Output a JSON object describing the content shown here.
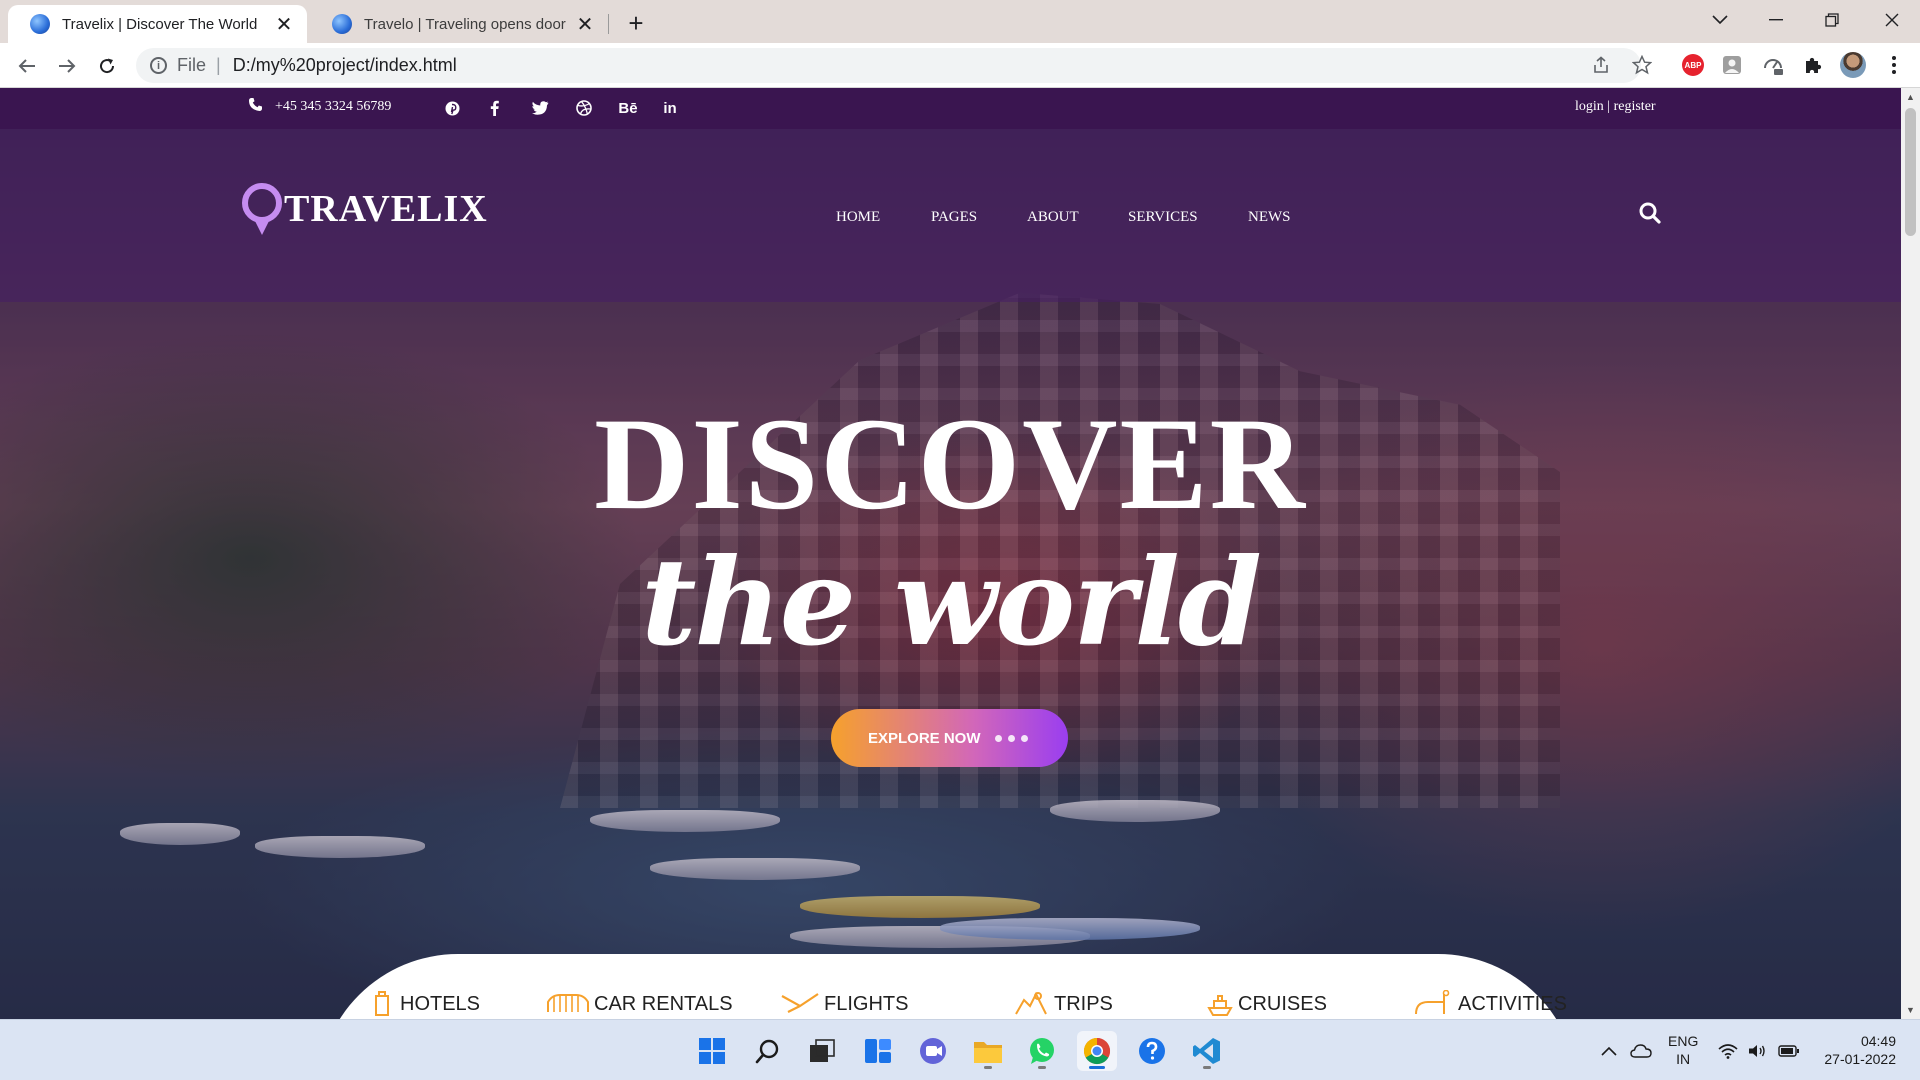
{
  "browser": {
    "tabs": [
      {
        "title": "Travelix | Discover The World",
        "active": true
      },
      {
        "title": "Travelo | Traveling opens door to",
        "active": false
      }
    ],
    "address": {
      "scheme": "File",
      "url": "D:/my%20project/index.html"
    }
  },
  "site": {
    "topbar": {
      "phone": "+45 345 3324 56789",
      "social_icons": [
        "pinterest-icon",
        "facebook-icon",
        "twitter-icon",
        "dribbble-icon",
        "behance-icon",
        "linkedin-icon"
      ],
      "behance_text": "Bē",
      "linkedin_text": "in",
      "login": "login",
      "separator": " | ",
      "register": "register"
    },
    "header": {
      "brand": "TRAVELIX",
      "menu": [
        "HOME",
        "PAGES",
        "ABOUT",
        "SERVICES",
        "NEWS"
      ]
    },
    "hero": {
      "headline": "DISCOVER",
      "subheadline": "the world",
      "cta": "EXPLORE NOW"
    },
    "services": [
      "HOTELS",
      "CAR RENTALS",
      "FLIGHTS",
      "TRIPS",
      "CRUISES",
      "ACTIVITIES"
    ],
    "colors": {
      "topbar": "#3a1550",
      "header_overlay": "rgba(70,30,100,0.55)",
      "cta_start": "#f6a12c",
      "cta_end": "#9a3ef0",
      "logo_pin": "#c58cf0",
      "service_icon": "#f6a12c"
    }
  },
  "taskbar": {
    "apps": [
      "windows-start-icon",
      "search-icon",
      "task-view-icon",
      "widgets-icon",
      "teams-chat-icon",
      "file-explorer-icon",
      "whatsapp-icon",
      "chrome-icon",
      "help-icon",
      "vscode-icon"
    ],
    "language": "ENG",
    "region": "IN",
    "time": "04:49",
    "date": "27-01-2022"
  }
}
